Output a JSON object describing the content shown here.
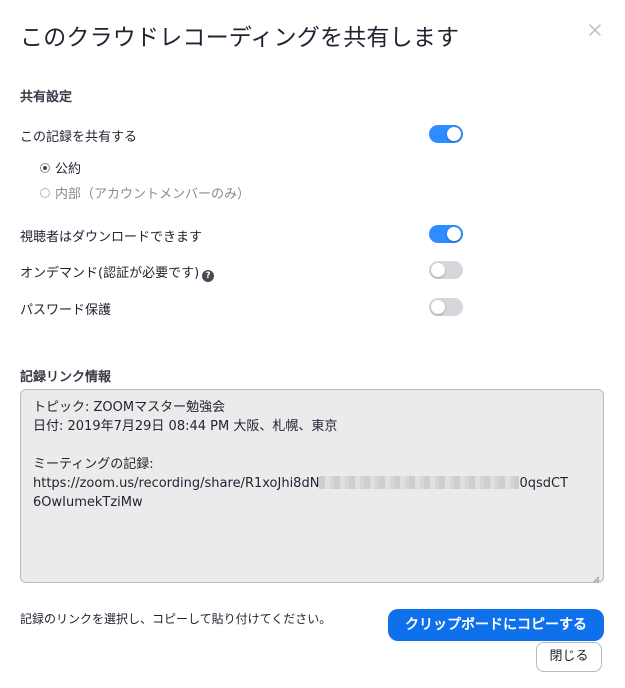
{
  "dialog": {
    "title": "このクラウドレコーディングを共有します",
    "close_icon": "close-icon"
  },
  "share_settings": {
    "heading": "共有設定",
    "share_record": {
      "label": "この記録を共有する",
      "enabled": true
    },
    "visibility": {
      "options": [
        {
          "label": "公約",
          "selected": true,
          "disabled": false
        },
        {
          "label": "内部（アカウントメンバーのみ）",
          "selected": false,
          "disabled": true
        }
      ]
    },
    "viewer_download": {
      "label": "視聴者はダウンロードできます",
      "enabled": true
    },
    "on_demand": {
      "label": "オンデマンド(認証が必要です)",
      "enabled": false,
      "help_icon": "help-icon"
    },
    "password": {
      "label": "パスワード保護",
      "enabled": false
    }
  },
  "record_link": {
    "heading": "記録リンク情報",
    "topic": "トピック: ZOOMマスター勉強会",
    "date": "日付: 2019年7月29日 08:44 PM 大阪、札幌、東京",
    "meeting_record_label": "ミーティングの記録:",
    "url_start": "https://zoom.us/recording/share/R1xoJhi8dN",
    "url_end": "0qsdCT",
    "url_line2": "6OwIumekTziMw"
  },
  "footer": {
    "hint": "記録のリンクを選択し、コピーして貼り付けてください。",
    "copy_button": "クリップボードにコピーする",
    "close_button": "閉じる"
  },
  "colors": {
    "accent": "#2d8cff",
    "primary_button": "#0e71eb",
    "toggle_off": "#d7d7db",
    "text": "#232333"
  }
}
